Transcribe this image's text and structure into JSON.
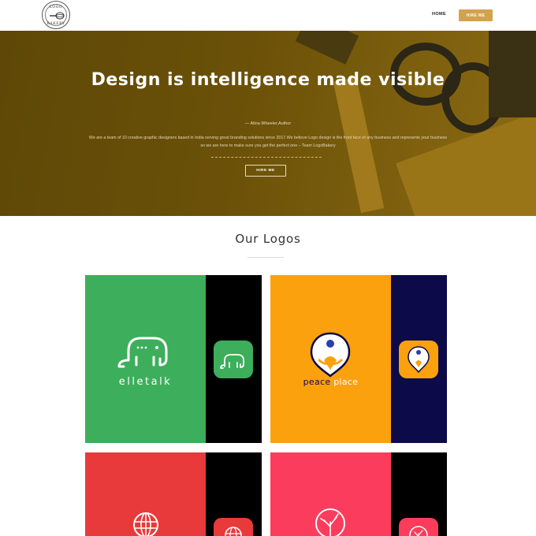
{
  "header": {
    "logo": {
      "top_text": "LOGO",
      "bottom_text": "BAKERY"
    },
    "nav": {
      "home_label": "HOME",
      "hire_label": "HIRE ME"
    }
  },
  "hero": {
    "title": "Design is intelligence made visible",
    "quote": "— Alina Wheeler,Author",
    "description": "We are a team of 10 creative graphic designers based in India serving great branding solutions since 2017.We believe Logo design is the front face of any business and represents your business so we are here to make sure you get the perfect one – Team LogoBakery",
    "button_label": "HIRE ME"
  },
  "section": {
    "title": "Our Logos"
  },
  "logos": [
    {
      "brand_text": "elletalk",
      "main_color": "#3dae5b",
      "side_color": "#000000",
      "icon_color": "#3dae5b"
    },
    {
      "brand_text_a": "peace",
      "brand_text_b": "place",
      "main_color": "#fba10d",
      "side_color": "#0d0a4a",
      "icon_color": "#fba10d"
    },
    {
      "main_color": "#e83a3a",
      "side_color": "#000000",
      "icon_color": "#e83a3a"
    },
    {
      "main_color": "#fc3c5c",
      "side_color": "#000000",
      "icon_color": "#fc3c5c"
    }
  ],
  "colors": {
    "accent": "#d2a24c",
    "hero_bg": "#6b5108"
  }
}
